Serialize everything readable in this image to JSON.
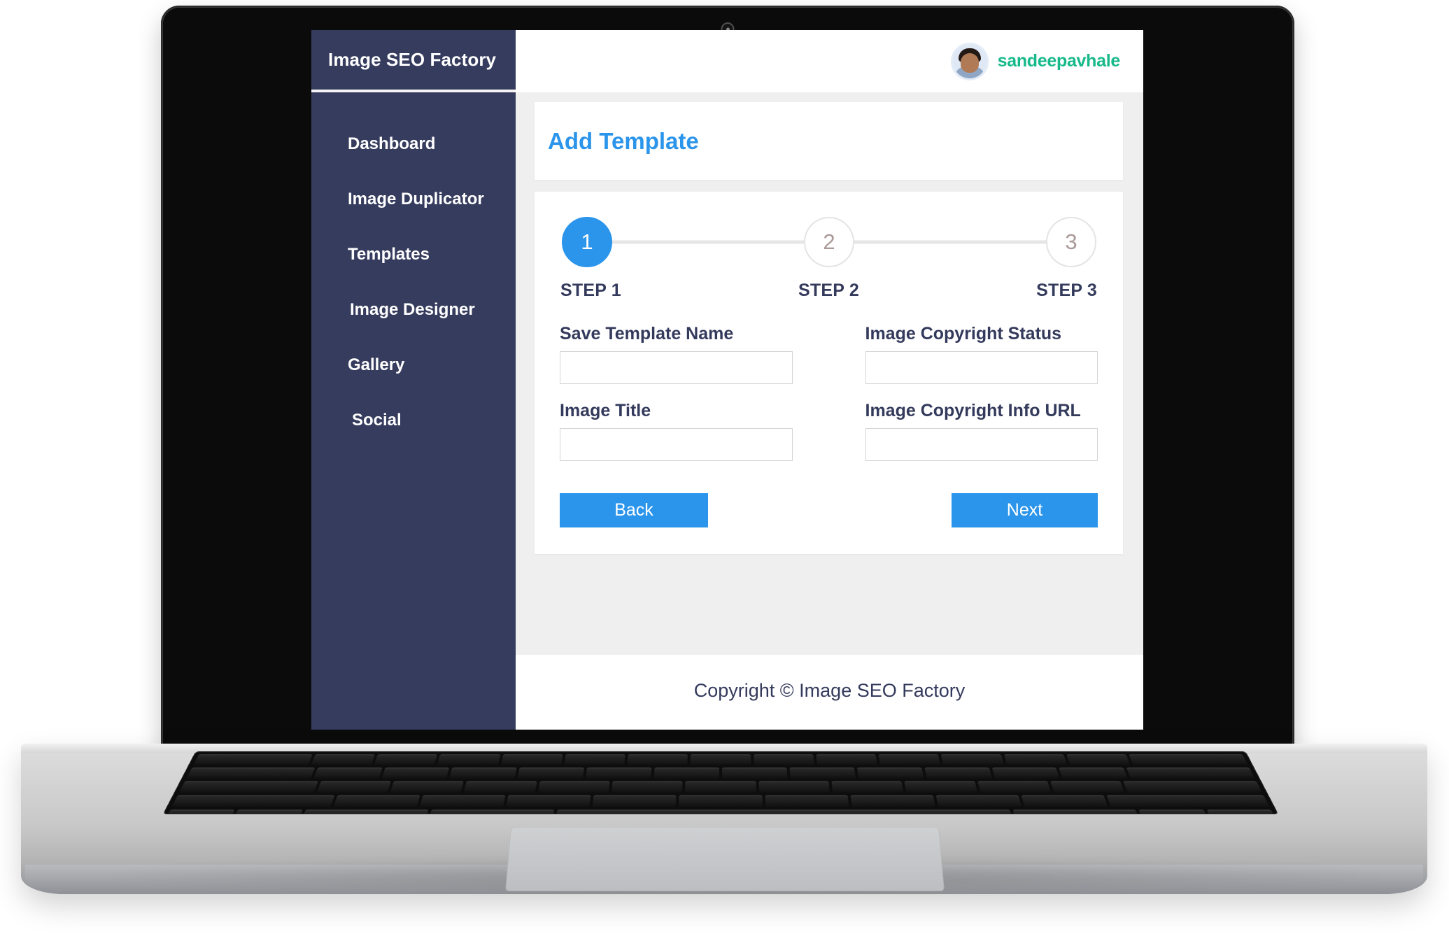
{
  "app": {
    "brand": "Image SEO Factory",
    "footer": "Copyright © Image SEO Factory"
  },
  "sidebar": {
    "items": [
      {
        "label": "Dashboard"
      },
      {
        "label": "Image Duplicator"
      },
      {
        "label": "Templates"
      },
      {
        "label": "Image Designer"
      },
      {
        "label": "Gallery"
      },
      {
        "label": "Social"
      }
    ]
  },
  "topbar": {
    "username": "sandeepavhale",
    "avatar_alt": "user-avatar"
  },
  "page": {
    "title": "Add Template"
  },
  "stepper": {
    "steps": [
      {
        "number": "1",
        "label": "STEP 1",
        "active": true
      },
      {
        "number": "2",
        "label": "STEP 2",
        "active": false
      },
      {
        "number": "3",
        "label": "STEP 3",
        "active": false
      }
    ]
  },
  "form": {
    "fields": [
      {
        "label": "Save Template Name",
        "value": "",
        "placeholder": ""
      },
      {
        "label": "Image Copyright Status",
        "value": "",
        "placeholder": ""
      },
      {
        "label": "Image Title",
        "value": "",
        "placeholder": ""
      },
      {
        "label": "Image Copyright Info URL",
        "value": "",
        "placeholder": ""
      }
    ],
    "back_label": "Back",
    "next_label": "Next"
  },
  "colors": {
    "sidebar_bg": "#363c5e",
    "accent_blue": "#2b95eb",
    "username_teal": "#17b98a",
    "text_navy": "#343a5c",
    "page_bg": "#efefef"
  }
}
